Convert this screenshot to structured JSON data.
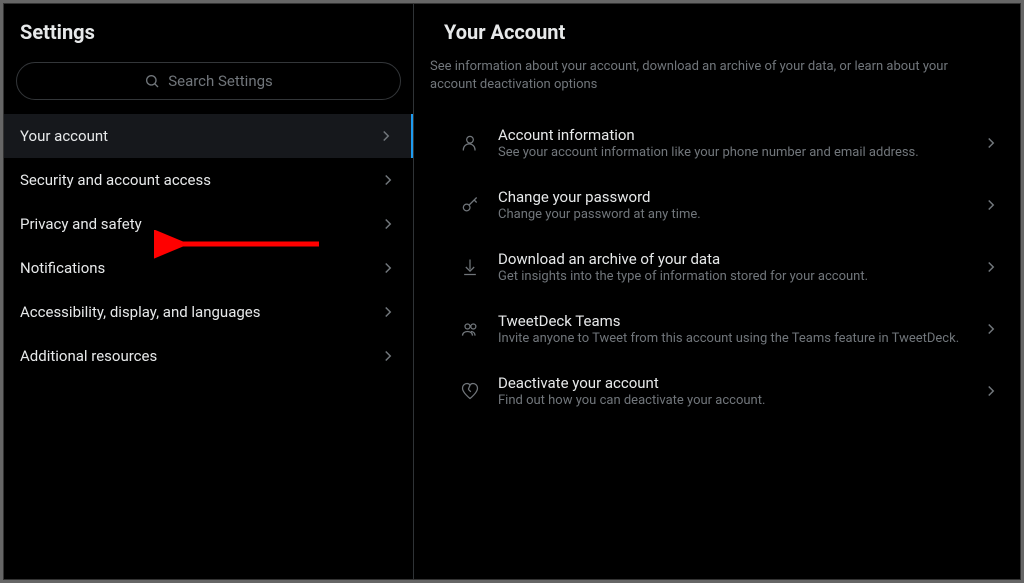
{
  "sidebar": {
    "title": "Settings",
    "search_placeholder": "Search Settings",
    "items": [
      {
        "label": "Your account"
      },
      {
        "label": "Security and account access"
      },
      {
        "label": "Privacy and safety"
      },
      {
        "label": "Notifications"
      },
      {
        "label": "Accessibility, display, and languages"
      },
      {
        "label": "Additional resources"
      }
    ]
  },
  "main": {
    "title": "Your Account",
    "description": "See information about your account, download an archive of your data, or learn about your account deactivation options",
    "items": [
      {
        "title": "Account information",
        "subtitle": "See your account information like your phone number and email address."
      },
      {
        "title": "Change your password",
        "subtitle": "Change your password at any time."
      },
      {
        "title": "Download an archive of your data",
        "subtitle": "Get insights into the type of information stored for your account."
      },
      {
        "title": "TweetDeck Teams",
        "subtitle": "Invite anyone to Tweet from this account using the Teams feature in TweetDeck."
      },
      {
        "title": "Deactivate your account",
        "subtitle": "Find out how you can deactivate your account."
      }
    ]
  }
}
